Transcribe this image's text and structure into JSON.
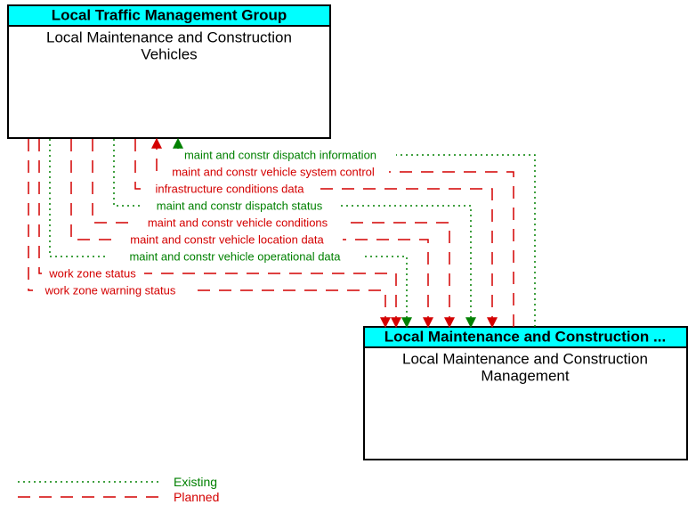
{
  "boxes": {
    "top": {
      "header": "Local Traffic Management Group",
      "body_line1": "Local Maintenance and Construction",
      "body_line2": "Vehicles"
    },
    "bottom": {
      "header": "Local Maintenance and Construction ...",
      "body_line1": "Local Maintenance and Construction",
      "body_line2": "Management"
    }
  },
  "flows": [
    {
      "label": "maint and constr dispatch information",
      "status": "existing",
      "direction": "to_top"
    },
    {
      "label": "maint and constr vehicle system control",
      "status": "planned",
      "direction": "to_top"
    },
    {
      "label": "infrastructure conditions data",
      "status": "planned",
      "direction": "to_bottom"
    },
    {
      "label": "maint and constr dispatch status",
      "status": "existing",
      "direction": "to_bottom"
    },
    {
      "label": "maint and constr vehicle conditions",
      "status": "planned",
      "direction": "to_bottom"
    },
    {
      "label": "maint and constr vehicle location data",
      "status": "planned",
      "direction": "to_bottom"
    },
    {
      "label": "maint and constr vehicle operational data",
      "status": "existing",
      "direction": "to_bottom"
    },
    {
      "label": "work zone status",
      "status": "planned",
      "direction": "to_bottom"
    },
    {
      "label": "work zone warning status",
      "status": "planned",
      "direction": "to_bottom"
    }
  ],
  "legend": {
    "existing": "Existing",
    "planned": "Planned"
  },
  "colors": {
    "header_fill": "#00ffff",
    "planned": "#d40000",
    "existing": "#008000"
  }
}
